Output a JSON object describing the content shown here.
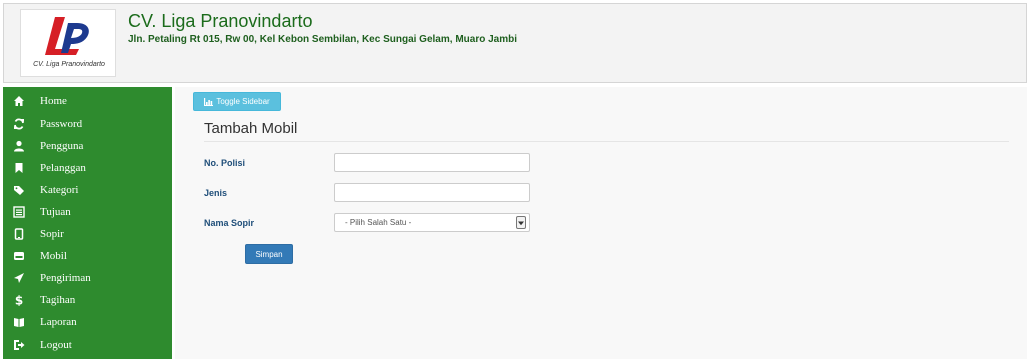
{
  "header": {
    "company_name": "CV. Liga Pranovindarto",
    "address": "Jln. Petaling Rt 015, Rw 00, Kel Kebon Sembilan, Kec Sungai Gelam, Muaro Jambi",
    "logo_caption": "CV. Liga Pranovindarto",
    "logo_colors": {
      "red": "#d61f26",
      "blue": "#1d3a8f"
    }
  },
  "sidebar": {
    "background": "#2e8b2e",
    "items": [
      {
        "label": "Home",
        "icon": "home-icon"
      },
      {
        "label": "Password",
        "icon": "refresh-icon"
      },
      {
        "label": "Pengguna",
        "icon": "user-icon"
      },
      {
        "label": "Pelanggan",
        "icon": "bookmark-icon"
      },
      {
        "label": "Kategori",
        "icon": "tags-icon"
      },
      {
        "label": "Tujuan",
        "icon": "list-alt-icon"
      },
      {
        "label": "Sopir",
        "icon": "phone-icon"
      },
      {
        "label": "Mobil",
        "icon": "hdd-icon"
      },
      {
        "label": "Pengiriman",
        "icon": "send-icon"
      },
      {
        "label": "Tagihan",
        "icon": "dollar-icon"
      },
      {
        "label": "Laporan",
        "icon": "book-icon"
      },
      {
        "label": "Logout",
        "icon": "logout-icon"
      }
    ]
  },
  "main": {
    "toggle_label": "Toggle Sidebar",
    "page_title": "Tambah Mobil",
    "form": {
      "no_polisi_label": "No. Polisi",
      "no_polisi_value": "",
      "jenis_label": "Jenis",
      "jenis_value": "",
      "nama_sopir_label": "Nama Sopir",
      "nama_sopir_selected": "- Pilih Salah Satu -",
      "submit_label": "Simpan"
    }
  }
}
